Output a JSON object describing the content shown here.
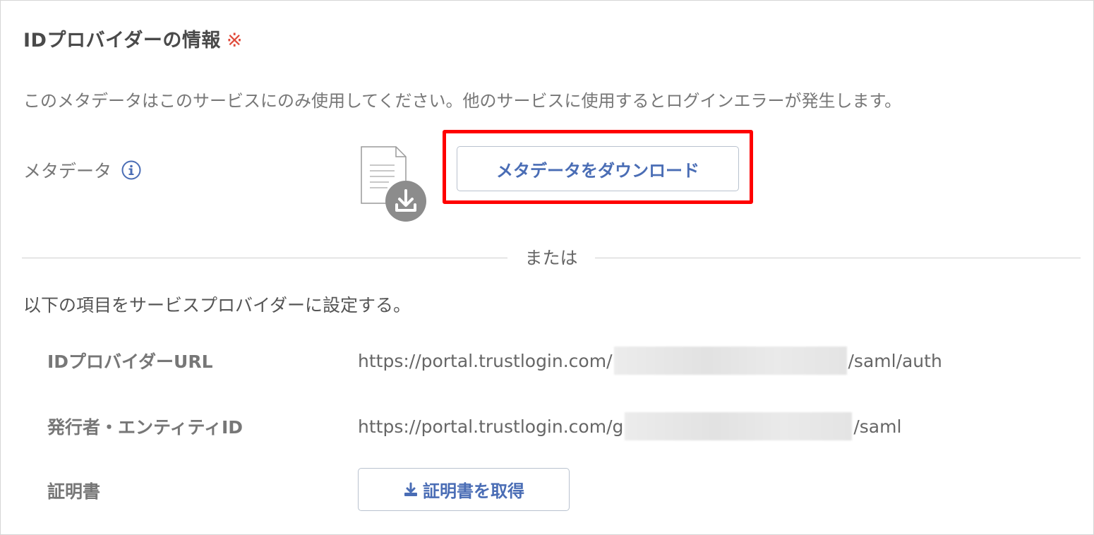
{
  "section": {
    "title": "IDプロバイダーの情報",
    "required_mark": "※"
  },
  "notice": "このメタデータはこのサービスにのみ使用してください。他のサービスに使用するとログインエラーが発生します。",
  "metadata": {
    "label": "メタデータ",
    "download_button": "メタデータをダウンロード"
  },
  "divider": {
    "text": "または"
  },
  "instruction": "以下の項目をサービスプロバイダーに設定する。",
  "fields": {
    "idp_url": {
      "label": "IDプロバイダーURL",
      "value_prefix": "https://portal.trustlogin.com/",
      "value_suffix": "/saml/auth"
    },
    "entity_id": {
      "label": "発行者・エンティティID",
      "value_prefix": "https://portal.trustlogin.com/g",
      "value_suffix": "/saml"
    },
    "certificate": {
      "label": "証明書",
      "button": "証明書を取得"
    }
  },
  "colors": {
    "accent": "#4a6db5",
    "required": "#e04a3a",
    "highlight": "#ff0000"
  },
  "icons": {
    "info": "info-circle-icon",
    "file": "document-download-icon",
    "download": "download-tray-icon"
  }
}
